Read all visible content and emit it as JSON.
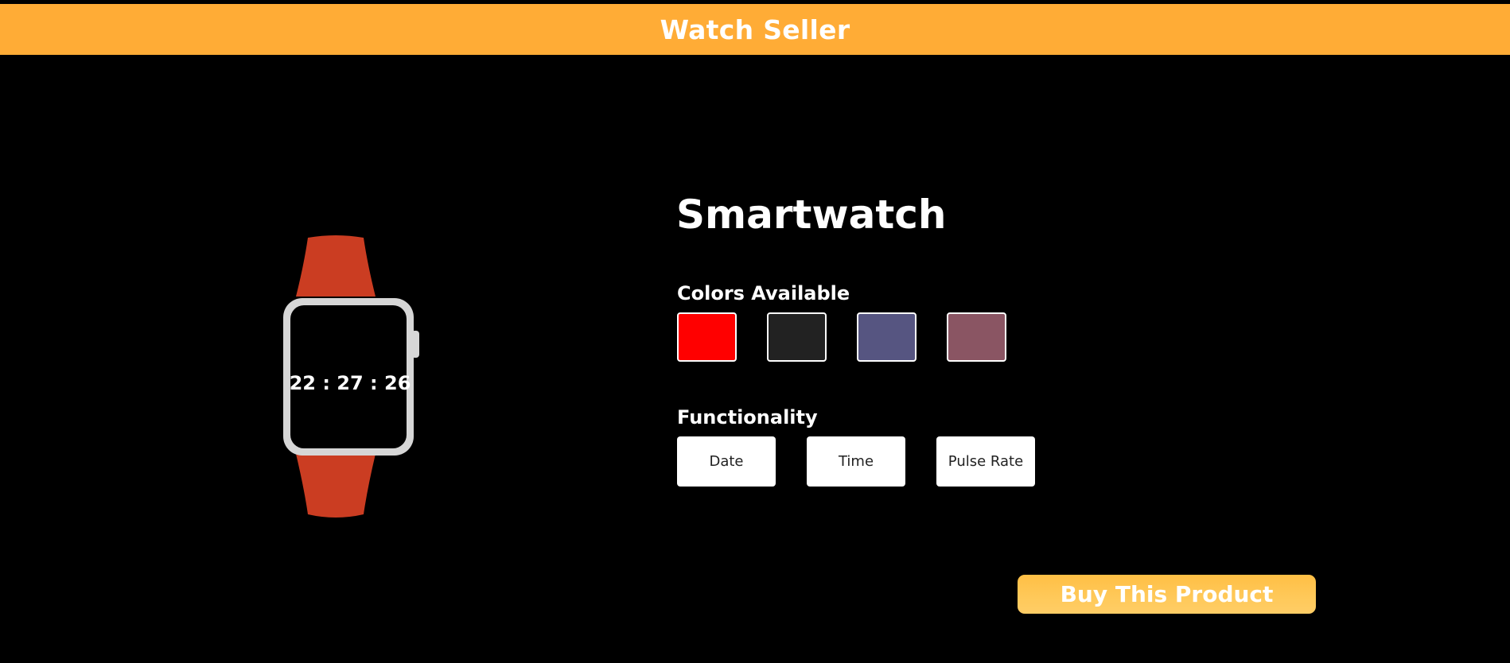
{
  "header": {
    "title": "Watch Seller",
    "background_color": "#ffac36"
  },
  "watch": {
    "time_display": "22 : 27 : 26",
    "band_color": "#cb3d22",
    "case_color": "#d6d6d6"
  },
  "product": {
    "title": "Smartwatch",
    "colors_label": "Colors Available",
    "colors": [
      {
        "name": "red",
        "hex": "#ff0000"
      },
      {
        "name": "black",
        "hex": "#222222"
      },
      {
        "name": "slate-blue",
        "hex": "#565581"
      },
      {
        "name": "plum",
        "hex": "#8a5563"
      }
    ],
    "functionality_label": "Functionality",
    "functions": [
      "Date",
      "Time",
      "Pulse Rate"
    ]
  },
  "actions": {
    "buy_label": "Buy This Product"
  }
}
